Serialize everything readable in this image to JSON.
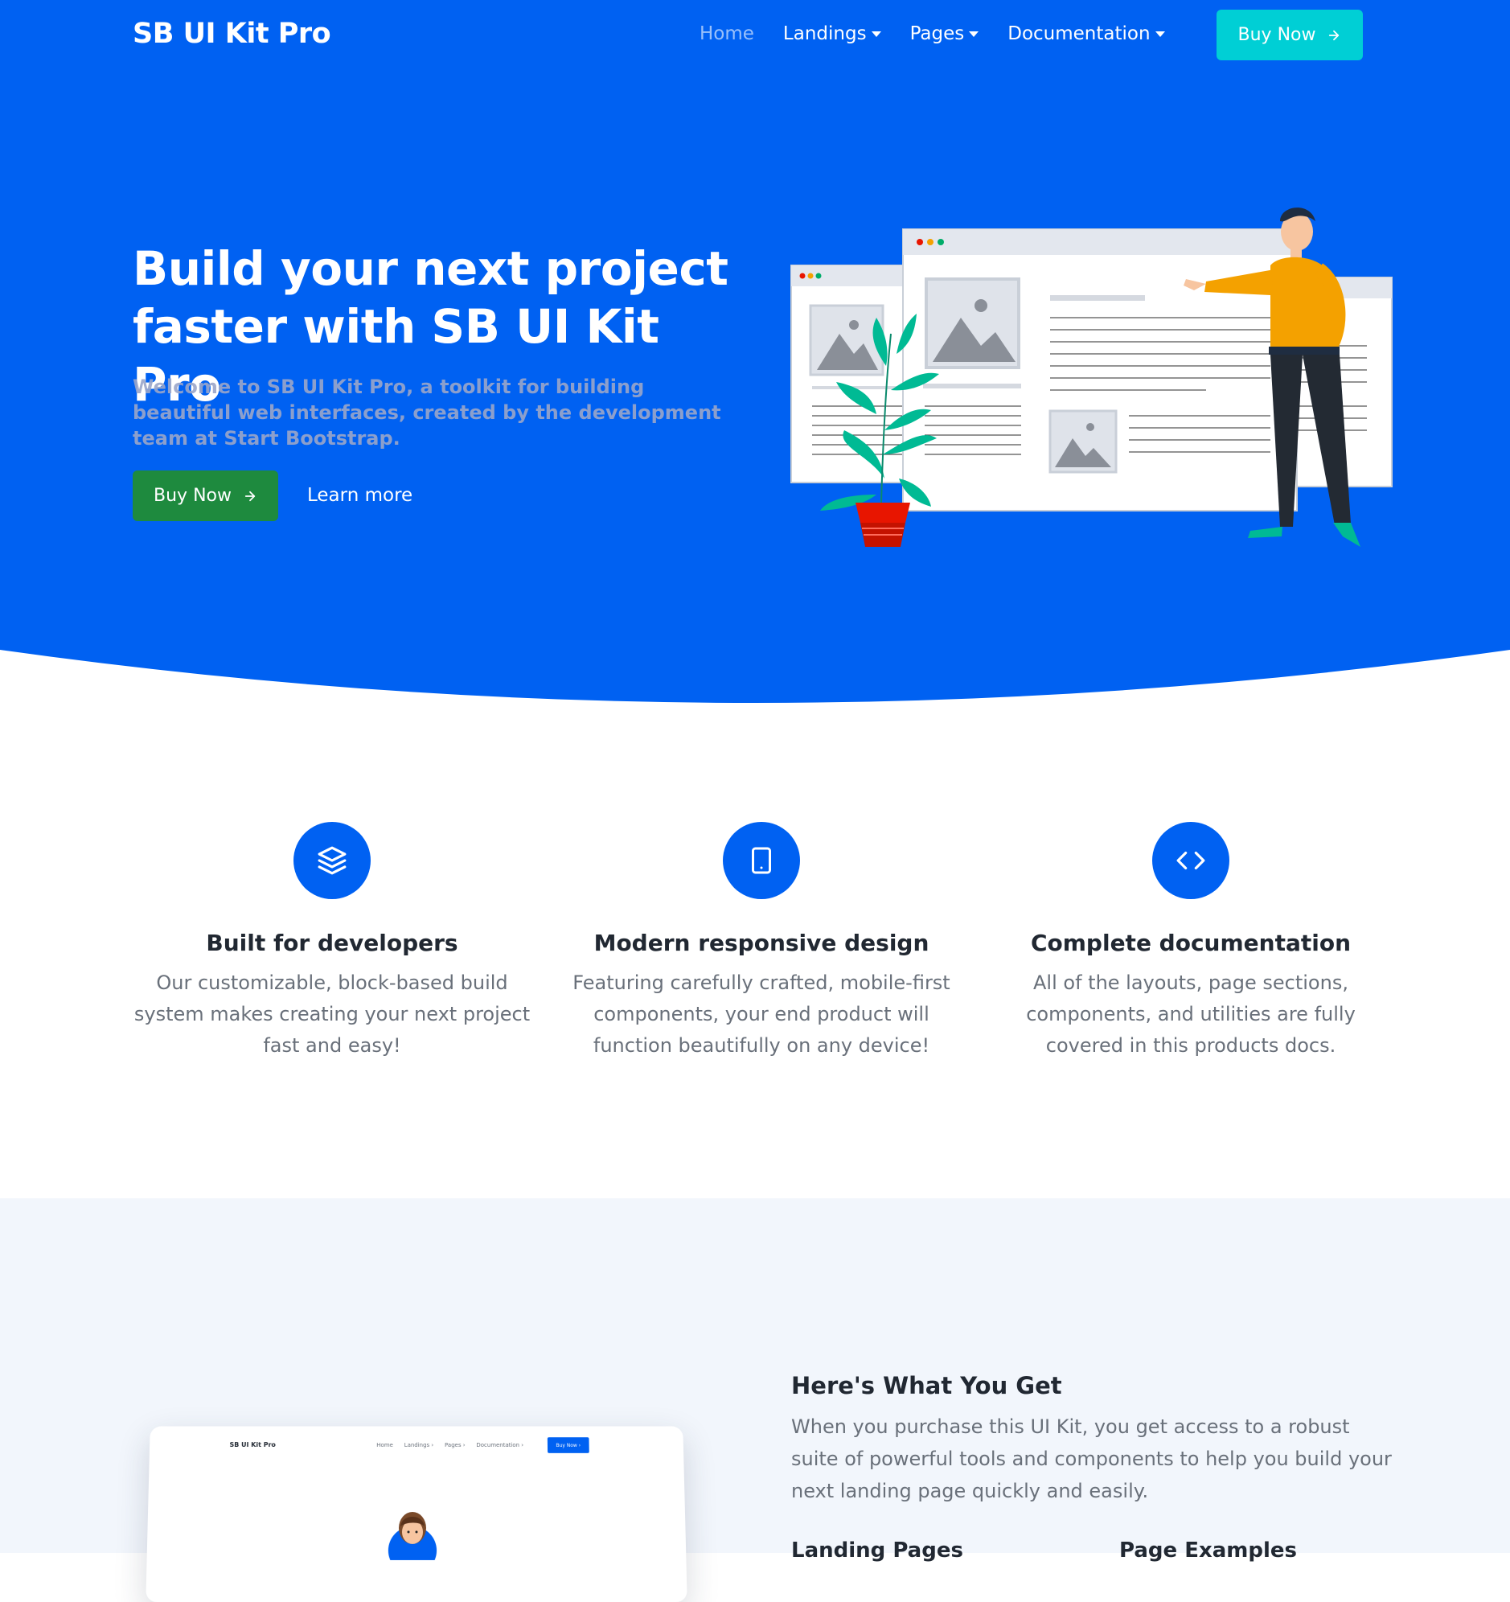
{
  "brand": "SB UI Kit Pro",
  "nav": {
    "items": [
      {
        "label": "Home",
        "active": true,
        "dropdown": false
      },
      {
        "label": "Landings",
        "active": false,
        "dropdown": true
      },
      {
        "label": "Pages",
        "active": false,
        "dropdown": true
      },
      {
        "label": "Documentation",
        "active": false,
        "dropdown": true
      }
    ],
    "buy_label": "Buy Now",
    "buy_color": "#00cfd5"
  },
  "hero": {
    "title": "Build your next project faster with SB UI Kit Pro",
    "lead": "Welcome to SB UI Kit Pro, a toolkit for building beautiful web interfaces, created by the development team at Start Bootstrap.",
    "primary_button": "Buy Now",
    "secondary_link": "Learn more",
    "background": "#0061f2"
  },
  "features": [
    {
      "icon": "layers-icon",
      "title": "Built for developers",
      "text": "Our customizable, block-based build system makes creating your next project fast and easy!"
    },
    {
      "icon": "tablet-icon",
      "title": "Modern responsive design",
      "text": "Featuring carefully crafted, mobile-first components, your end product will function beautifully on any device!"
    },
    {
      "icon": "code-icon",
      "title": "Complete documentation",
      "text": "All of the layouts, page sections, components, and utilities are fully covered in this products docs."
    }
  ],
  "what_you_get": {
    "title": "Here's What You Get",
    "lead": "When you purchase this UI Kit, you get access to a robust suite of powerful tools and components to help you build your next landing page quickly and easily.",
    "sub_left": "Landing Pages",
    "sub_right": "Page Examples"
  },
  "mockup": {
    "brand": "SB UI Kit Pro",
    "links": [
      "Home",
      "Landings ›",
      "Pages ›",
      "Documentation ›"
    ],
    "buy": "Buy Now ›"
  }
}
